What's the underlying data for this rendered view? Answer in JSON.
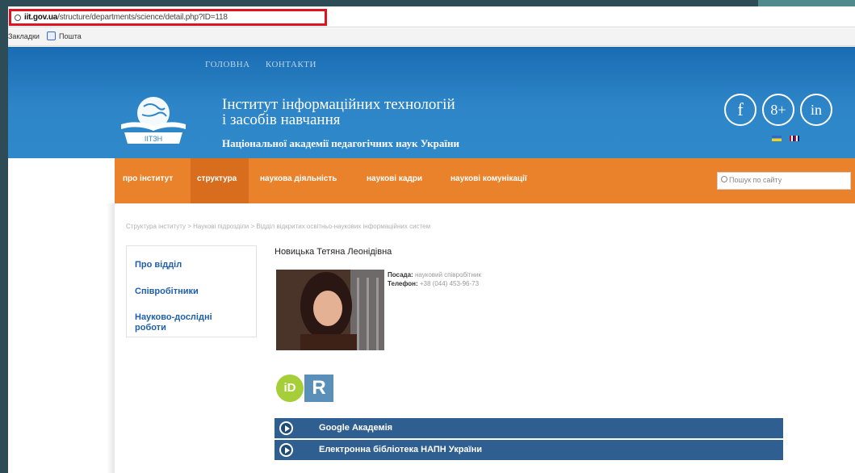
{
  "browser": {
    "url_domain": "iit.gov.ua",
    "url_path": "/structure/departments/science/detail.php?ID=118",
    "bookmarks_label": "Закладки",
    "bookmark_item": "Пошта"
  },
  "header": {
    "top_nav": [
      "ГОЛОВНА",
      "КОНТАКТИ"
    ],
    "title_line1": "Інститут інформаційних технологій",
    "title_line2": "і засобів навчання",
    "subtitle": "Національної академії педагогічних наук України",
    "logo_text": "ІІТЗН",
    "social": [
      "f",
      "8+",
      "in"
    ]
  },
  "menu": {
    "items": [
      "про інститут",
      "структура",
      "наукова діяльність",
      "наукові кадри",
      "наукові комунікації"
    ],
    "active": "структура",
    "search_placeholder": "Пошук по сайту"
  },
  "breadcrumb": "Структура інституту  >  Наукові підрозділи  >  Відділ відкритих освітньо-наукових інформаційних систем",
  "sidebar": {
    "items": [
      {
        "label": "Про відділ"
      },
      {
        "label": "Співробітники"
      },
      {
        "label": "Науково-дослідні роботи"
      }
    ]
  },
  "profile": {
    "name": "Новицька Тетяна Леонідівна",
    "position_label": "Посада:",
    "position_value": "науковий співробітник",
    "phone_label": "Телефон:",
    "phone_value": "+38 (044) 453-96-73",
    "orcid_text": "iD",
    "rg_text": "R"
  },
  "links": [
    {
      "label": "Google Академія"
    },
    {
      "label": "Електронна бібліотека НАПН України"
    }
  ],
  "colors": {
    "header_blue": "#2e86c8",
    "menu_orange": "#e9822b",
    "link_bar": "#2f5e90",
    "url_highlight": "#e0141e"
  }
}
